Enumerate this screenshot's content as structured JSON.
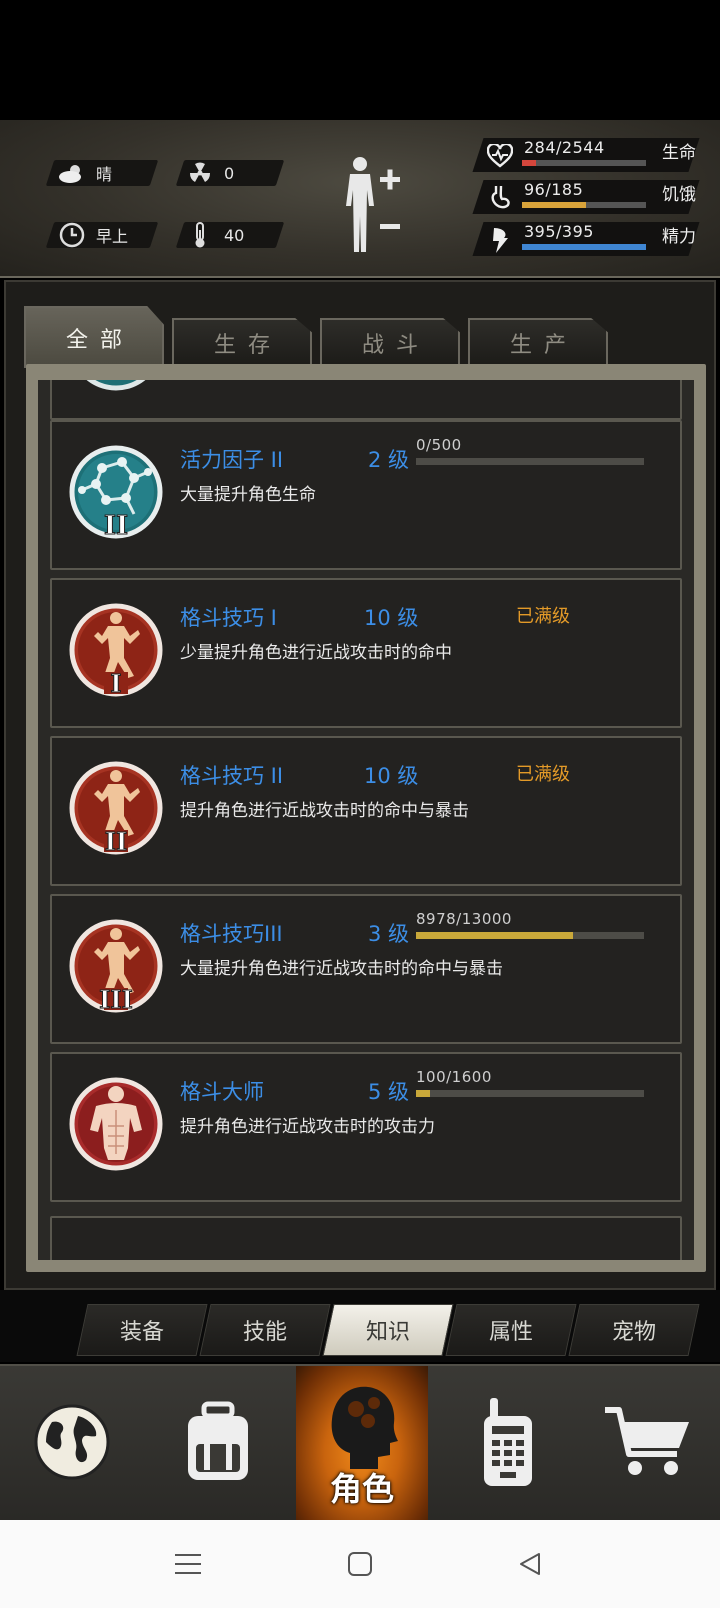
{
  "status": {
    "weather": {
      "icon": "cloud-sun-icon",
      "text": "晴"
    },
    "radiation": {
      "icon": "radiation-icon",
      "value": "0"
    },
    "time": {
      "icon": "clock-icon",
      "text": "早上"
    },
    "temperature": {
      "icon": "thermometer-icon",
      "value": "40"
    },
    "body_icon": "body-plus-minus-icon",
    "bars": [
      {
        "label": "生命",
        "value": "284/2544",
        "fraction": 0.112,
        "color": "#d4463c",
        "icon": "heart-icon"
      },
      {
        "label": "饥饿",
        "value": "96/185",
        "fraction": 0.519,
        "color": "#d9a33a",
        "icon": "stomach-icon"
      },
      {
        "label": "精力",
        "value": "395/395",
        "fraction": 1.0,
        "color": "#3f86d3",
        "icon": "energy-icon"
      }
    ]
  },
  "tabs": [
    {
      "label": "全部",
      "active": true
    },
    {
      "label": "生存",
      "active": false
    },
    {
      "label": "战斗",
      "active": false
    },
    {
      "label": "生产",
      "active": false
    }
  ],
  "items": [
    {
      "name": "活力因子 II",
      "level": "2 级",
      "desc": "大量提升角色生命",
      "progress_text": "0/500",
      "progress": 0.0,
      "maxed": "",
      "icon": "molecule-icon"
    },
    {
      "name": "格斗技巧 I",
      "level": "10 级",
      "desc": "少量提升角色进行近战攻击时的命中",
      "progress_text": "",
      "progress": null,
      "maxed": "已满级",
      "icon": "martial-arts-icon"
    },
    {
      "name": "格斗技巧 II",
      "level": "10 级",
      "desc": "提升角色进行近战攻击时的命中与暴击",
      "progress_text": "",
      "progress": null,
      "maxed": "已满级",
      "icon": "martial-arts-icon"
    },
    {
      "name": "格斗技巧III",
      "level": "3 级",
      "desc": "大量提升角色进行近战攻击时的命中与暴击",
      "progress_text": "8978/13000",
      "progress": 0.6906,
      "maxed": "",
      "icon": "martial-arts-icon"
    },
    {
      "name": "格斗大师",
      "level": "5 级",
      "desc": "提升角色进行近战攻击时的攻击力",
      "progress_text": "100/1600",
      "progress": 0.0625,
      "maxed": "",
      "icon": "muscle-torso-icon"
    }
  ],
  "sub_tabs": [
    {
      "label": "装备",
      "active": false
    },
    {
      "label": "技能",
      "active": false
    },
    {
      "label": "知识",
      "active": true
    },
    {
      "label": "属性",
      "active": false
    },
    {
      "label": "宠物",
      "active": false
    }
  ],
  "bottom_nav": [
    {
      "icon": "globe-icon",
      "label": "",
      "active": false
    },
    {
      "icon": "backpack-icon",
      "label": "",
      "active": false
    },
    {
      "icon": "head-icon",
      "label": "角色",
      "active": true
    },
    {
      "icon": "walkie-talkie-icon",
      "label": "",
      "active": false
    },
    {
      "icon": "cart-icon",
      "label": "",
      "active": false
    }
  ],
  "android_nav": [
    "menu-icon",
    "home-icon",
    "back-icon"
  ]
}
